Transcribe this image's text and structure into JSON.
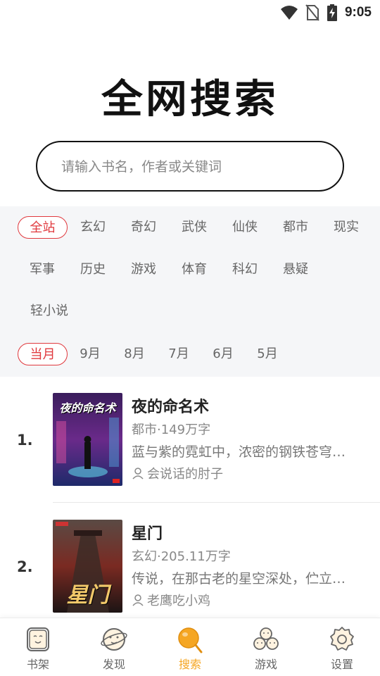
{
  "status_bar": {
    "time": "9:05"
  },
  "title": "全网搜索",
  "search": {
    "placeholder": "请输入书名，作者或关键词"
  },
  "categories": [
    "全站",
    "玄幻",
    "奇幻",
    "武侠",
    "仙侠",
    "都市",
    "现实",
    "军事",
    "历史",
    "游戏",
    "体育",
    "科幻",
    "悬疑",
    "轻小说"
  ],
  "months": [
    "当月",
    "9月",
    "8月",
    "7月",
    "6月",
    "5月"
  ],
  "books": [
    {
      "rank": "1.",
      "title": "夜的命名术",
      "meta": "都市·149万字",
      "desc": "蓝与紫的霓虹中，浓密的钢铁苍穹…",
      "author": "会说话的肘子",
      "cover_text": "夜的命名术"
    },
    {
      "rank": "2.",
      "title": "星门",
      "meta": "玄幻·205.11万字",
      "desc": "传说，在那古老的星空深处，伫立…",
      "author": "老鹰吃小鸡",
      "cover_text": "星门"
    }
  ],
  "nav": [
    {
      "label": "书架",
      "icon": "bookshelf-icon"
    },
    {
      "label": "发现",
      "icon": "discover-icon"
    },
    {
      "label": "搜索",
      "icon": "search-icon"
    },
    {
      "label": "游戏",
      "icon": "game-icon"
    },
    {
      "label": "设置",
      "icon": "settings-icon"
    }
  ],
  "colors": {
    "accent": "#e0393e",
    "nav_active": "#f5a623"
  }
}
